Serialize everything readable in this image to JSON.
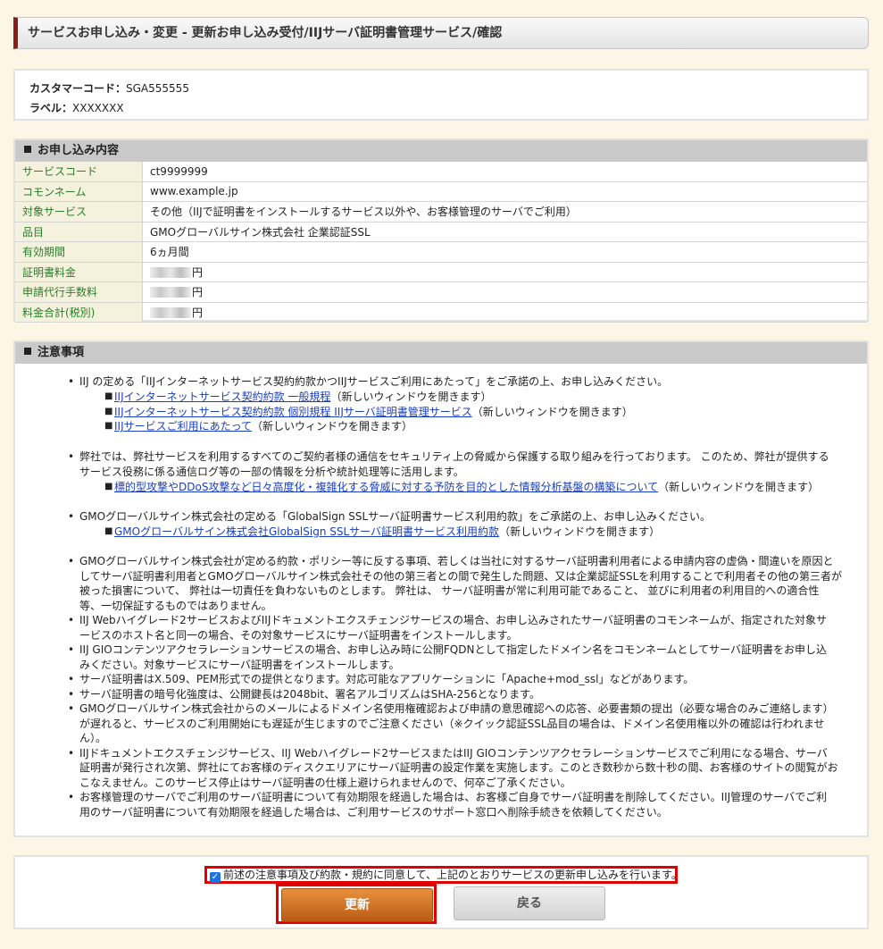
{
  "page_title": "サービスお申し込み・変更 - 更新お申し込み受付/IIJサーバ証明書管理サービス/確認",
  "customer": {
    "code_label": "カスタマーコード：",
    "code_value": "SGA555555",
    "label_label": "ラベル：",
    "label_value": "XXXXXXX"
  },
  "application": {
    "heading": "お申し込み内容",
    "rows": [
      {
        "key": "サービスコード",
        "value": "ct9999999"
      },
      {
        "key": "コモンネーム",
        "value": "www.example.jp"
      },
      {
        "key": "対象サービス",
        "value": "その他（IIJで証明書をインストールするサービス以外や、お客様管理のサーバでご利用）"
      },
      {
        "key": "品目",
        "value": "GMOグローバルサイン株式会社 企業認証SSL"
      },
      {
        "key": "有効期間",
        "value": "6ヵ月間"
      },
      {
        "key": "証明書料金",
        "value": "円"
      },
      {
        "key": "申請代行手数料",
        "value": "円"
      },
      {
        "key": "料金合計(税別)",
        "value": "円"
      }
    ]
  },
  "notes": {
    "heading": "注意事項",
    "n1": "IIJ の定める「IIJインターネットサービス契約約款かつIIJサービスご利用にあたって」をご承諾の上、お申し込みください。",
    "n1_links": [
      {
        "text": "IIJインターネットサービス契約約款 一般規程",
        "suffix": "（新しいウィンドウを開きます）"
      },
      {
        "text": "IIJインターネットサービス契約約款 個別規程 IIJサーバ証明書管理サービス",
        "suffix": "（新しいウィンドウを開きます）"
      },
      {
        "text": "IIJサービスご利用にあたって",
        "suffix": "（新しいウィンドウを開きます）"
      }
    ],
    "n2a": "弊社では、弊社サービスを利用するすべてのご契約者様の通信をセキュリティ上の脅威から保護する取り組みを行っております。 このため、弊社が提供する",
    "n2b": "サービス役務に係る通信ログ等の一部の情報を分析や統計処理等に活用します。",
    "n2_link": {
      "text": "標的型攻撃やDDoS攻撃など日々高度化・複雑化する脅威に対する予防を目的とした情報分析基盤の構築について",
      "suffix": "（新しいウィンドウを開きます）"
    },
    "n3": "GMOグローバルサイン株式会社の定める「GlobalSign SSLサーバ証明書サービス利用約款」をご承諾の上、お申し込みください。",
    "n3_link": {
      "text": "GMOグローバルサイン株式会社GlobalSign SSLサーバ証明書サービス利用約款",
      "suffix": "（新しいウィンドウを開きます）"
    },
    "n4": [
      "GMOグローバルサイン株式会社が定める約款・ポリシー等に反する事項、若しくは当社に対するサーバ証明書利用者による申請内容の虚偽・間違いを原因と",
      "してサーバ証明書利用者とGMOグローバルサイン株式会社その他の第三者との間で発生した問題、又は企業認証SSLを利用することで利用者その他の第三者が",
      "被った損害について、 弊社は一切責任を負わないものとします。 弊社は、 サーバ証明書が常に利用可能であること、 並びに利用者の利用目的への適合性",
      "等、一切保証するものではありません。"
    ],
    "n5": [
      "IIJ Webハイグレード2サービスおよびIIJドキュメントエクスチェンジサービスの場合、お申し込みされたサーバ証明書のコモンネームが、指定された対象サ",
      "ービスのホスト名と同一の場合、その対象サービスにサーバ証明書をインストールします。"
    ],
    "n6": [
      "IIJ GIOコンテンツアクセラレーションサービスの場合、お申し込み時に公開FQDNとして指定したドメイン名をコモンネームとしてサーバ証明書をお申し込",
      "みください。対象サービスにサーバ証明書をインストールします。"
    ],
    "n7": "サーバ証明書はX.509、PEM形式での提供となります。対応可能なアプリケーションに「Apache+mod_ssl」などがあります。",
    "n8": "サーバ証明書の暗号化強度は、公開鍵長は2048bit、署名アルゴリズムはSHA-256となります。",
    "n9": [
      "GMOグローバルサイン株式会社からのメールによるドメイン名使用権確認および申請の意思確認への応答、必要書類の提出（必要な場合のみご連絡します）",
      "が遅れると、サービスのご利用開始にも遅延が生じますのでご注意ください（※クイック認証SSL品目の場合は、ドメイン名使用権以外の確認は行われませ",
      "ん）。"
    ],
    "n10": [
      "IIJドキュメントエクスチェンジサービス、IIJ Webハイグレード2サービスまたはIIJ GIOコンテンツアクセラレーションサービスでご利用になる場合、サーバ",
      "証明書が発行され次第、弊社にてお客様のディスクエリアにサーバ証明書の設定作業を実施します。このとき数秒から数十秒の間、お客様のサイトの閲覧がお",
      "こなえません。このサービス停止はサーバ証明書の仕様上避けられませんので、何卒ご了承ください。"
    ],
    "n11": [
      "お客様管理のサーバでご利用のサーバ証明書について有効期限を経過した場合は、お客様ご自身でサーバ証明書を削除してください。IIJ管理のサーバでご利",
      "用のサーバ証明書について有効期限を経過した場合は、ご利用サービスのサポート窓口へ削除手続きを依頼してください。"
    ]
  },
  "agreement": {
    "checkbox_checked": true,
    "label": "前述の注意事項及び約款・規約に同意して、上記のとおりサービスの更新申し込みを行います。"
  },
  "buttons": {
    "update": "更新",
    "back": "戻る"
  },
  "colors": {
    "accent_bar": "#8a1c1c",
    "update_button": "#c9691f",
    "highlight_outline": "#e00000",
    "key_text": "#2a7d2a",
    "link": "#1a3fbf"
  }
}
